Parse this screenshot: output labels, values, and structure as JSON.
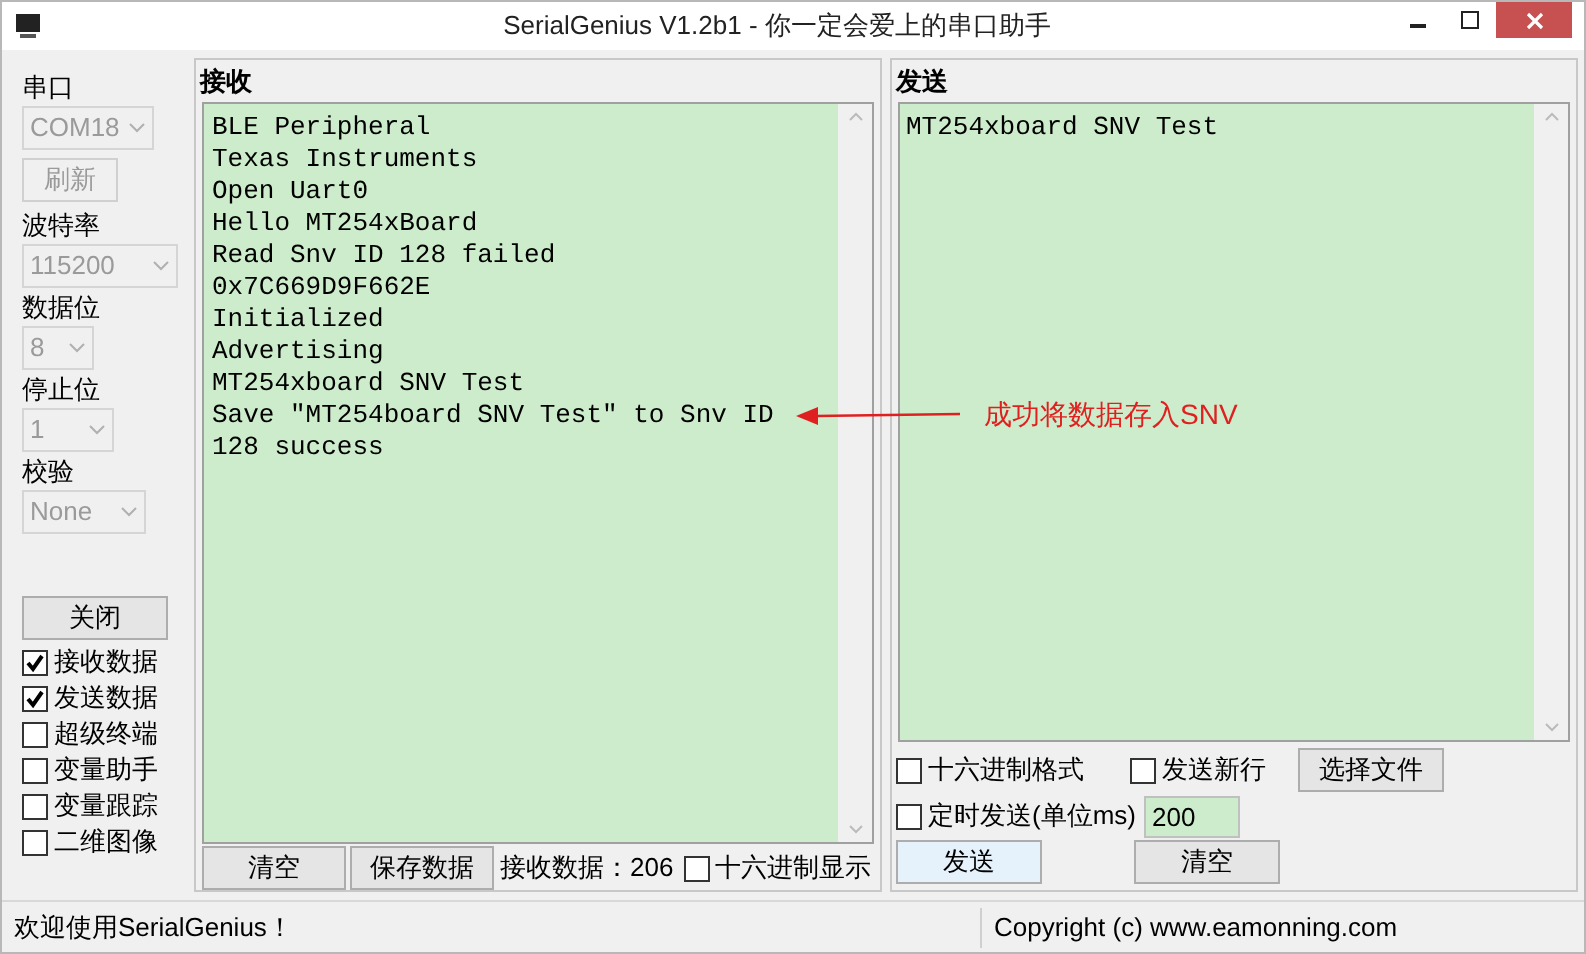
{
  "window": {
    "title": "SerialGenius V1.2b1 - 你一定会爱上的串口助手"
  },
  "sidebar": {
    "fields": [
      {
        "label": "串口",
        "value": "COM18",
        "disabled": true
      },
      {
        "kind": "button",
        "label": "刷新",
        "disabled": true
      },
      {
        "label": "波特率",
        "value": "115200",
        "disabled": true
      },
      {
        "label": "数据位",
        "value": "8",
        "disabled": true
      },
      {
        "label": "停止位",
        "value": "1",
        "disabled": true
      },
      {
        "label": "校验",
        "value": "None",
        "disabled": true
      }
    ],
    "close_button": "关闭",
    "checkboxes": [
      {
        "label": "接收数据",
        "checked": true
      },
      {
        "label": "发送数据",
        "checked": true
      },
      {
        "label": "超级终端",
        "checked": false
      },
      {
        "label": "变量助手",
        "checked": false
      },
      {
        "label": "变量跟踪",
        "checked": false
      },
      {
        "label": "二维图像",
        "checked": false
      }
    ]
  },
  "receive": {
    "title": "接收",
    "lines": [
      "BLE Peripheral",
      "Texas Instruments",
      "Open Uart0",
      "Hello MT254xBoard",
      "Read Snv ID 128 failed",
      "0x7C669D9F662E",
      "Initialized",
      "Advertising",
      "MT254xboard SNV Test",
      "Save \"MT254board SNV Test\" to Snv ID",
      "128 success"
    ],
    "buttons": [
      "清空",
      "保存数据"
    ],
    "count": "接收数据：206",
    "hex_display": {
      "label": "十六进制显示",
      "checked": false
    }
  },
  "send": {
    "title": "发送",
    "text": "MT254xboard SNV Test",
    "hex_format": {
      "label": "十六进制格式",
      "checked": false
    },
    "newline": {
      "label": "发送新行",
      "checked": false
    },
    "choose_file": "选择文件",
    "timed": {
      "label": "定时发送(单位ms)",
      "checked": false
    },
    "interval": "200",
    "send_button": "发送",
    "clear_button": "清空"
  },
  "status_bar": {
    "left": "欢迎使用SerialGenius！",
    "right": "Copyright (c) www.eamonning.com"
  },
  "annotation": {
    "text": "成功将数据存入SNV"
  }
}
